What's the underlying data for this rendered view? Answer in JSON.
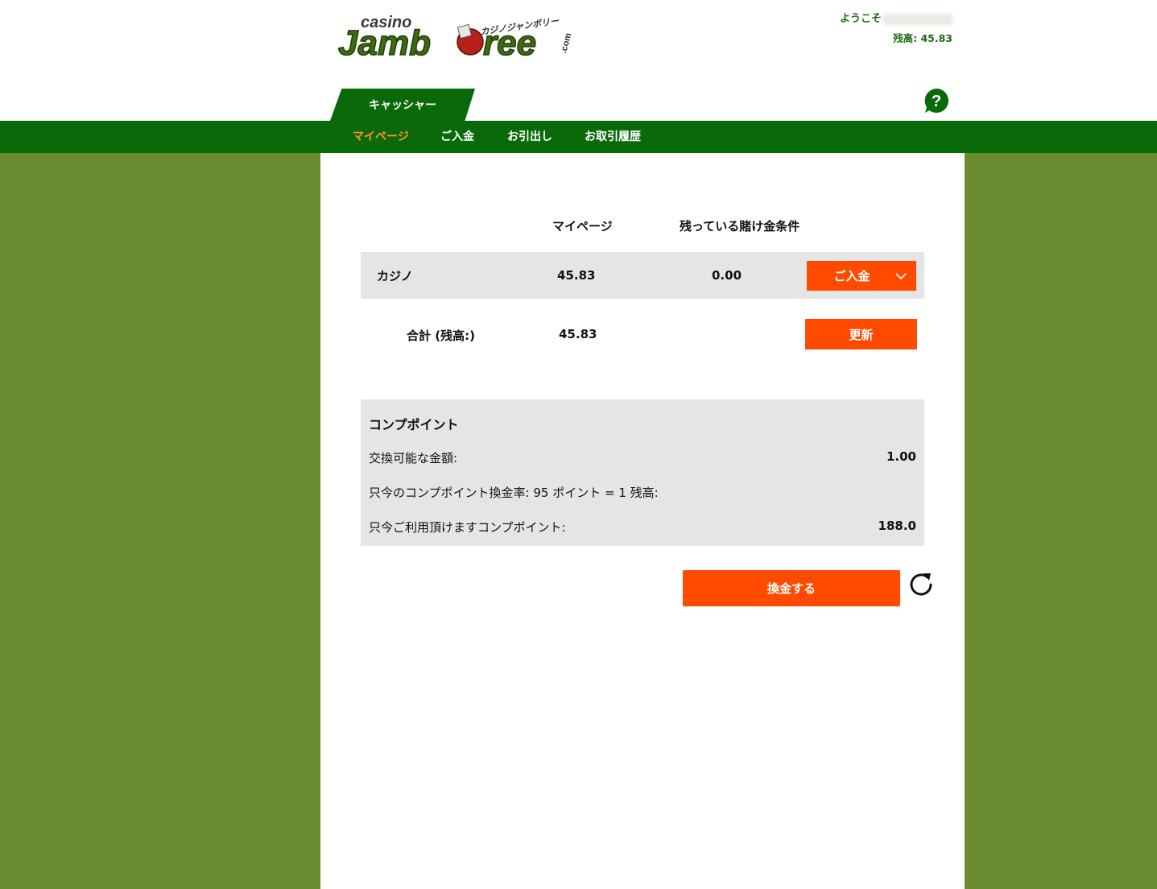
{
  "header": {
    "logo_text": "casino Jamboree .com",
    "logo_sub": "カジノジャンボリー",
    "welcome_label": "ようこそ",
    "balance_label": "残高: 45.83"
  },
  "tabs": {
    "cashier": "キャッシャー"
  },
  "nav": {
    "items": [
      {
        "label": "マイページ",
        "active": true
      },
      {
        "label": "ご入金",
        "active": false
      },
      {
        "label": "お引出し",
        "active": false
      },
      {
        "label": "お取引履歴",
        "active": false
      }
    ]
  },
  "table": {
    "headers": {
      "col1": "マイページ",
      "col2": "残っている賭け金条件"
    },
    "rows": [
      {
        "name": "カジノ",
        "balance": "45.83",
        "wagering": "0.00",
        "button": "ご入金"
      }
    ],
    "total": {
      "label": "合計 (残高:)",
      "value": "45.83",
      "button": "更新"
    }
  },
  "comp_points": {
    "title": "コンプポイント",
    "exchangeable_label": "交換可能な金額:",
    "exchangeable_value": "1.00",
    "rate_label": "只今のコンプポイント換金率: 95 ポイント = 1 残高:",
    "available_label": "只今ご利用頂けますコンプポイント:",
    "available_value": "188.0"
  },
  "actions": {
    "redeem_button": "換金する"
  },
  "colors": {
    "nav_green": "#0a6a0a",
    "side_green": "#6a8c30",
    "accent_orange": "#ff4a00",
    "active_nav": "#ff9326",
    "row_gray": "#e5e5e5"
  }
}
